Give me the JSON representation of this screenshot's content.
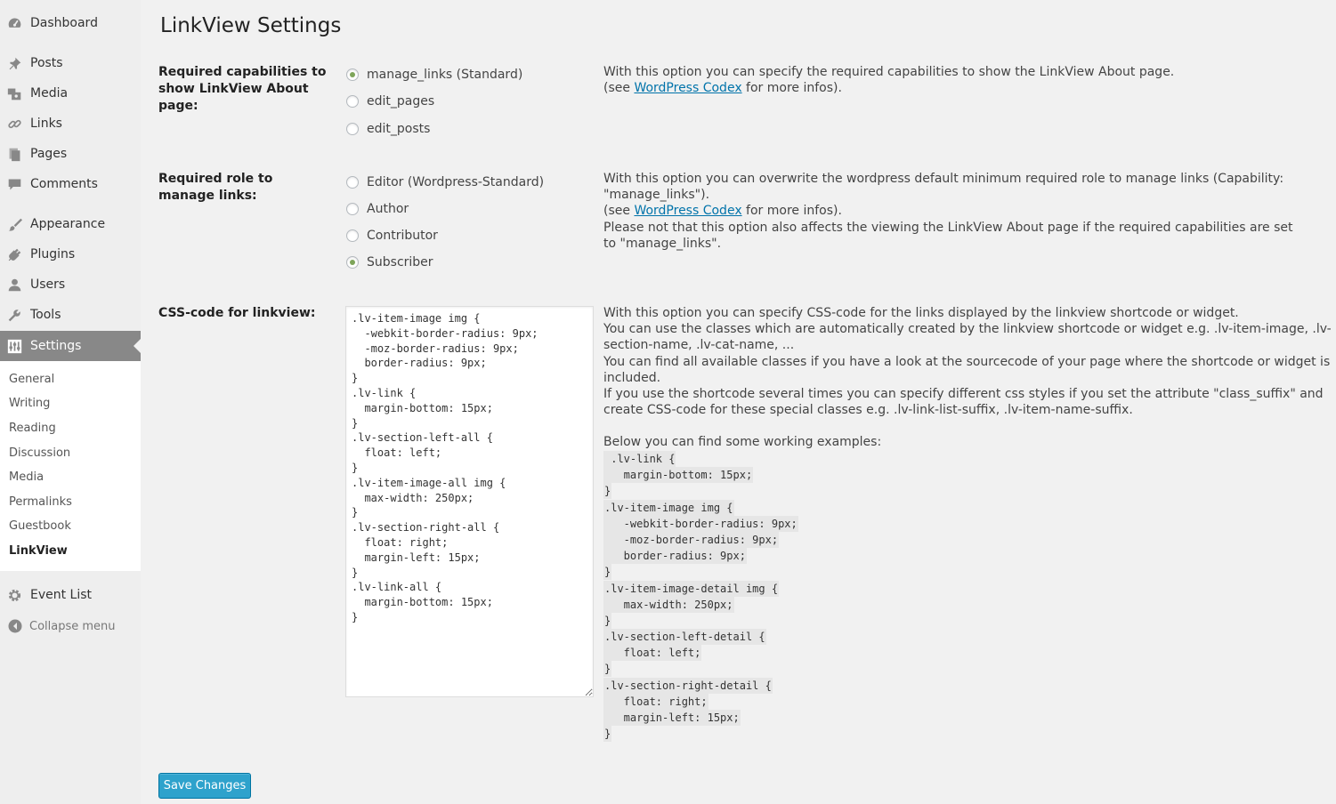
{
  "sidebar": {
    "items": [
      {
        "label": "Dashboard",
        "icon": "dashboard-icon"
      },
      {
        "label": "Posts",
        "icon": "pin-icon"
      },
      {
        "label": "Media",
        "icon": "media-icon"
      },
      {
        "label": "Links",
        "icon": "link-icon"
      },
      {
        "label": "Pages",
        "icon": "page-icon"
      },
      {
        "label": "Comments",
        "icon": "comment-icon"
      },
      {
        "label": "Appearance",
        "icon": "brush-icon"
      },
      {
        "label": "Plugins",
        "icon": "plug-icon"
      },
      {
        "label": "Users",
        "icon": "user-icon"
      },
      {
        "label": "Tools",
        "icon": "wrench-icon"
      },
      {
        "label": "Settings",
        "icon": "settings-icon",
        "current": true
      }
    ],
    "submenu": [
      "General",
      "Writing",
      "Reading",
      "Discussion",
      "Media",
      "Permalinks",
      "Guestbook",
      "LinkView"
    ],
    "submenu_current": "LinkView",
    "extra_item": {
      "label": "Event List",
      "icon": "gear-icon"
    },
    "collapse_label": "Collapse menu"
  },
  "page": {
    "title": "LinkView Settings"
  },
  "capabilities": {
    "label": "Required capabilities to show LinkView About page:",
    "options": [
      "manage_links (Standard)",
      "edit_pages",
      "edit_posts"
    ],
    "selected": "manage_links (Standard)",
    "desc_line1": "With this option you can specify the required capabilities to show the LinkView About page.",
    "desc_see_prefix": "(see ",
    "desc_link": "WordPress Codex",
    "desc_see_suffix": " for more infos)."
  },
  "role": {
    "label": "Required role to manage links:",
    "options": [
      "Editor (Wordpress-Standard)",
      "Author",
      "Contributor",
      "Subscriber"
    ],
    "selected": "Subscriber",
    "desc_line1": "With this option you can overwrite the wordpress default minimum required role to manage links (Capability: \"manage_links\").",
    "desc_see_prefix": "(see ",
    "desc_link": "WordPress Codex",
    "desc_see_suffix": " for more infos).",
    "desc_line3": "Please not that this option also affects the viewing the LinkView About page if the required capabilities are set to \"manage_links\"."
  },
  "css": {
    "label": "CSS-code for linkview:",
    "code": ".lv-item-image img {\n  -webkit-border-radius: 9px;\n  -moz-border-radius: 9px;\n  border-radius: 9px;\n}\n.lv-link {\n  margin-bottom: 15px;\n}\n.lv-section-left-all {\n  float: left;\n}\n.lv-item-image-all img {\n  max-width: 250px;\n}\n.lv-section-right-all {\n  float: right;\n  margin-left: 15px;\n}\n.lv-link-all {\n  margin-bottom: 15px;\n}",
    "desc_p1": "With this option you can specify CSS-code for the links displayed by the linkview shortcode or widget.",
    "desc_p2": "You can use the classes which are automatically created by the linkview shortcode or widget e.g. .lv-item-image, .lv-section-name, .lv-cat-name, ...",
    "desc_p3": "You can find all available classes if you have a look at the sourcecode of your page where the shortcode or widget is included.",
    "desc_p4": "If you use the shortcode several times you can specify different css styles if you set the attribute \"class_suffix\" and create CSS-code for these special classes e.g. .lv-link-list-suffix, .lv-item-name-suffix.",
    "desc_examples_intro": "Below you can find some working examples:",
    "examples": [
      " .lv-link {",
      "   margin-bottom: 15px;",
      "}",
      ".lv-item-image img {",
      "   -webkit-border-radius: 9px;",
      "   -moz-border-radius: 9px;",
      "   border-radius: 9px;",
      "}",
      ".lv-item-image-detail img {",
      "   max-width: 250px;",
      "}",
      ".lv-section-left-detail {",
      "   float: left;",
      "}",
      ".lv-section-right-detail {",
      "   float: right;",
      "   margin-left: 15px;",
      "}"
    ]
  },
  "save_label": "Save Changes",
  "colors": {
    "accent": "#2ea2cc",
    "link": "#0073aa",
    "radio_checked": "#7ea55a",
    "sidebar_current": "#888888"
  }
}
